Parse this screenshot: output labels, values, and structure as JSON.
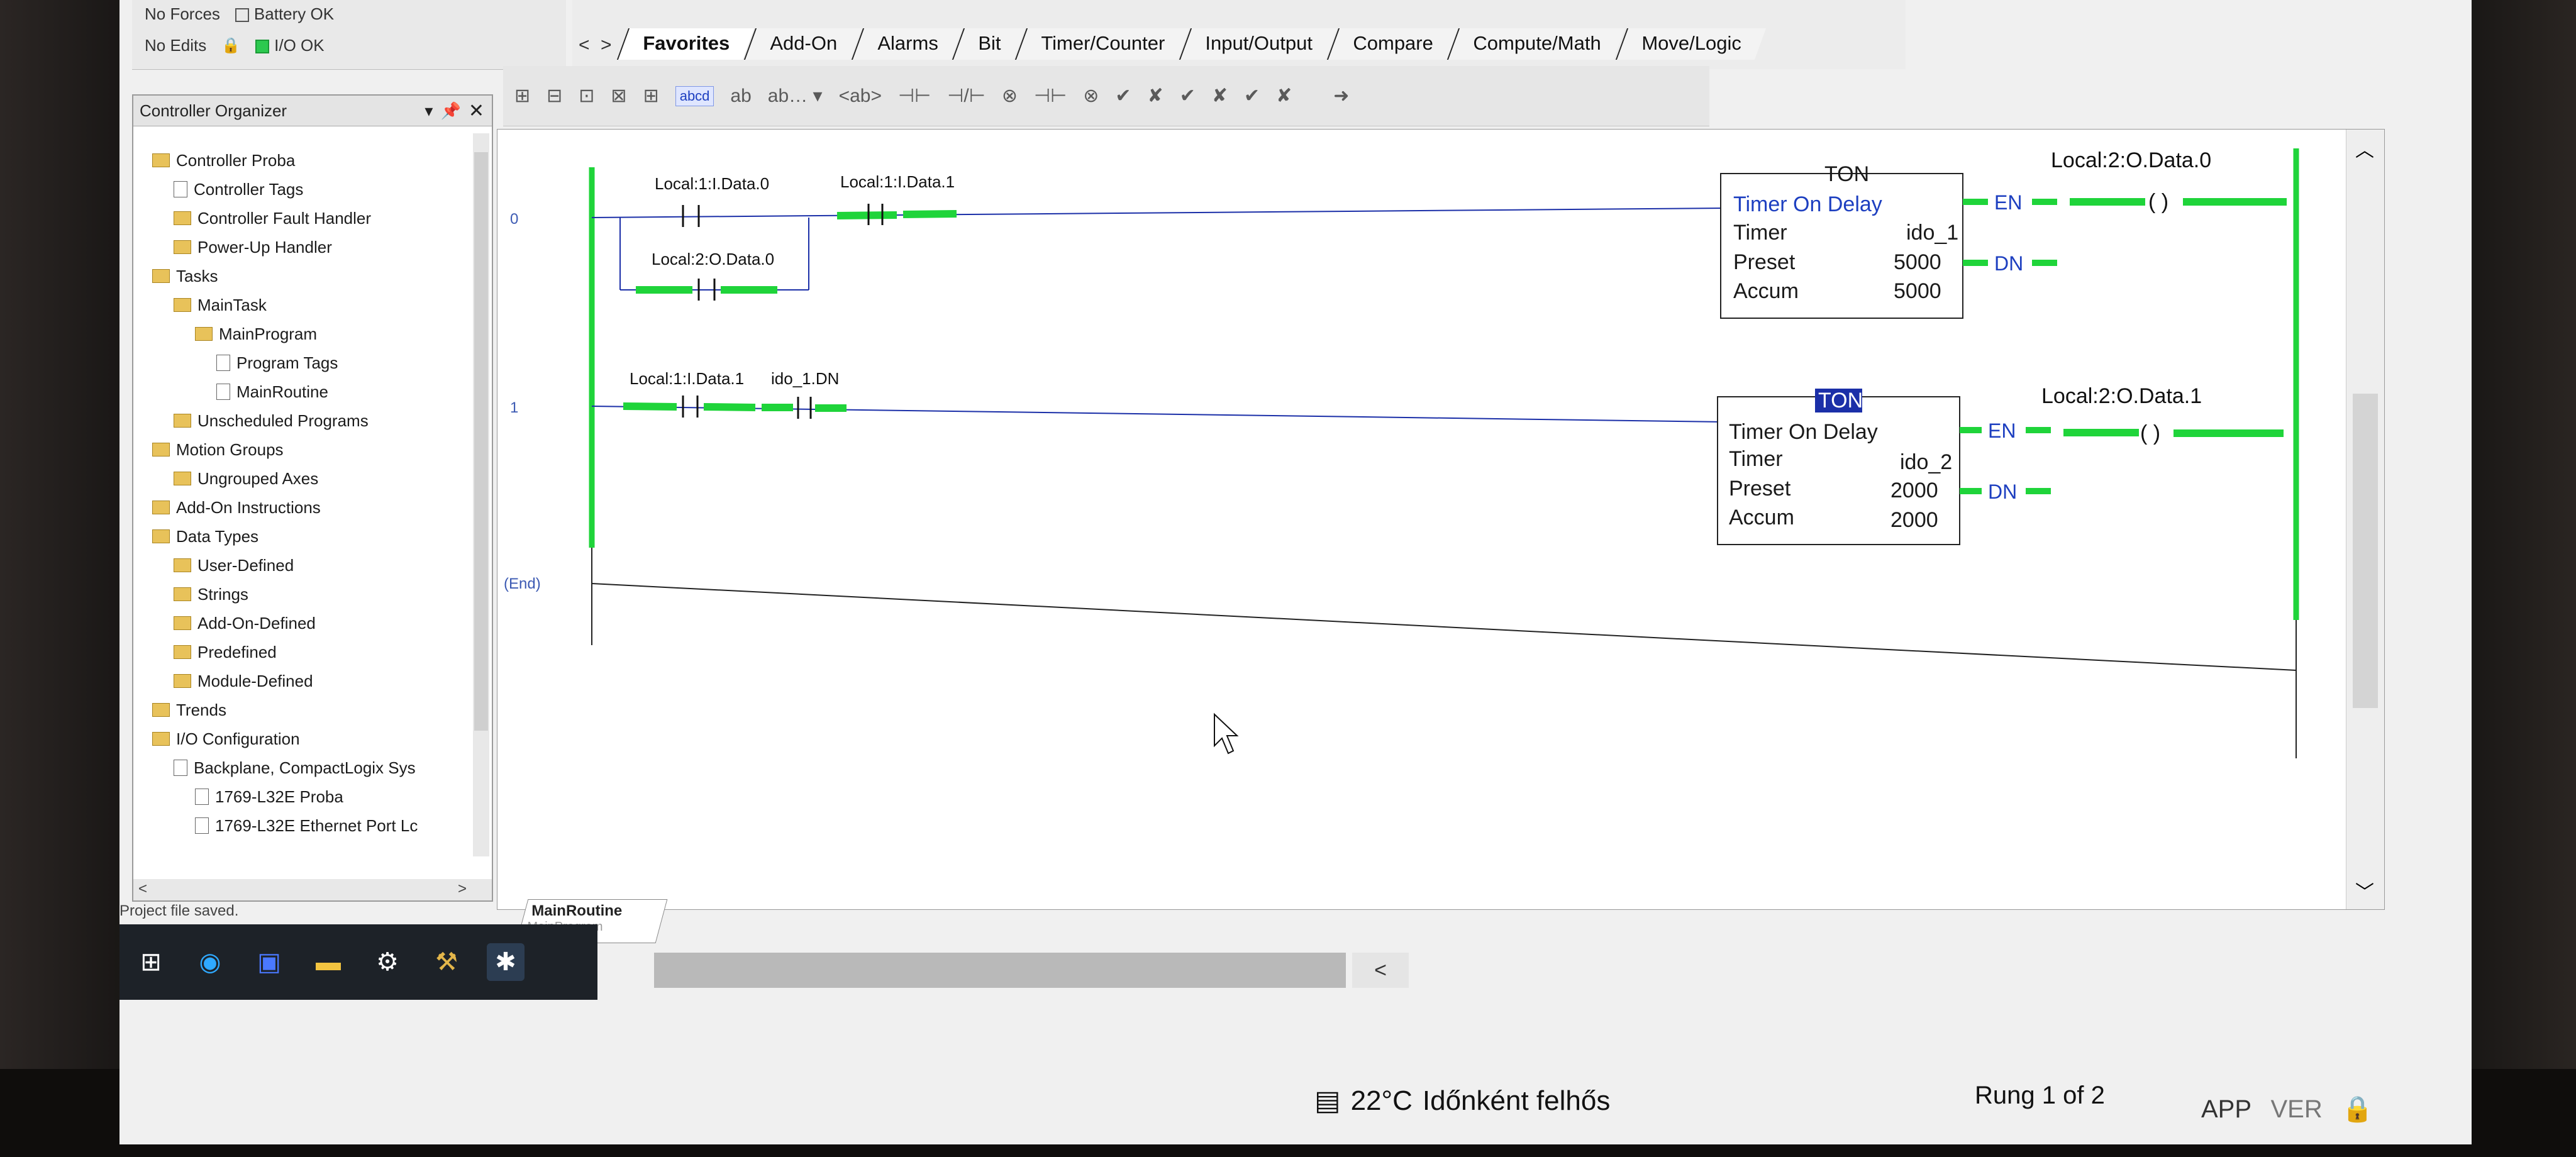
{
  "status": {
    "forces": "No Forces",
    "edits": "No Edits",
    "battery": "Battery OK",
    "io": "I/O OK"
  },
  "instruction_tabs": [
    "Favorites",
    "Add-On",
    "Alarms",
    "Bit",
    "Timer/Counter",
    "Input/Output",
    "Compare",
    "Compute/Math",
    "Move/Logic"
  ],
  "organizer": {
    "title": "Controller Organizer",
    "tree": [
      {
        "label": "Controller Proba",
        "level": 0,
        "icon": "folder-icon"
      },
      {
        "label": "Controller Tags",
        "level": 1,
        "icon": "tags-icon"
      },
      {
        "label": "Controller Fault Handler",
        "level": 1,
        "icon": "folder-icon"
      },
      {
        "label": "Power-Up Handler",
        "level": 1,
        "icon": "folder-icon"
      },
      {
        "label": "Tasks",
        "level": 0,
        "icon": "folder-icon"
      },
      {
        "label": "MainTask",
        "level": 1,
        "icon": "task-icon"
      },
      {
        "label": "MainProgram",
        "level": 2,
        "icon": "program-icon"
      },
      {
        "label": "Program Tags",
        "level": 3,
        "icon": "tags-icon"
      },
      {
        "label": "MainRoutine",
        "level": 3,
        "icon": "routine-icon"
      },
      {
        "label": "Unscheduled Programs",
        "level": 1,
        "icon": "folder-icon"
      },
      {
        "label": "Motion Groups",
        "level": 0,
        "icon": "folder-icon"
      },
      {
        "label": "Ungrouped Axes",
        "level": 1,
        "icon": "folder-icon"
      },
      {
        "label": "Add-On Instructions",
        "level": 0,
        "icon": "folder-icon"
      },
      {
        "label": "Data Types",
        "level": 0,
        "icon": "folder-icon"
      },
      {
        "label": "User-Defined",
        "level": 1,
        "icon": "folder-icon"
      },
      {
        "label": "Strings",
        "level": 1,
        "icon": "folder-icon"
      },
      {
        "label": "Add-On-Defined",
        "level": 1,
        "icon": "folder-icon"
      },
      {
        "label": "Predefined",
        "level": 1,
        "icon": "folder-icon"
      },
      {
        "label": "Module-Defined",
        "level": 1,
        "icon": "folder-icon"
      },
      {
        "label": "Trends",
        "level": 0,
        "icon": "folder-icon"
      },
      {
        "label": "I/O Configuration",
        "level": 0,
        "icon": "folder-icon"
      },
      {
        "label": "Backplane, CompactLogix Sys",
        "level": 1,
        "icon": "backplane-icon"
      },
      {
        "label": "1769-L32E Proba",
        "level": 2,
        "icon": "module-icon"
      },
      {
        "label": "1769-L32E Ethernet Port Lc",
        "level": 2,
        "icon": "ethernet-icon"
      }
    ]
  },
  "status_message": "Project file saved.",
  "ladder": {
    "rungs": [
      {
        "number": "0",
        "contacts": [
          "Local:1:I.Data.0",
          "Local:1:I.Data.1"
        ],
        "branch_contact": "Local:2:O.Data.0",
        "timer": {
          "type": "TON",
          "title": "Timer On Delay",
          "tag": "ido_1",
          "preset": "5000",
          "accum": "5000"
        },
        "en": "EN",
        "dn": "DN",
        "coil": "Local:2:O.Data.0"
      },
      {
        "number": "1",
        "contacts": [
          "Local:1:I.Data.1",
          "ido_1.DN"
        ],
        "timer": {
          "type": "TON",
          "title": "Timer On Delay",
          "tag": "ido_2",
          "preset": "2000",
          "accum": "2000"
        },
        "en": "EN",
        "dn": "DN",
        "coil": "Local:2:O.Data.1"
      }
    ],
    "end_label": "(End)",
    "field_labels": {
      "timer": "Timer",
      "preset": "Preset",
      "accum": "Accum"
    }
  },
  "routine_tab": {
    "name": "MainRoutine",
    "program": "MainProgram"
  },
  "bottom": {
    "temperature": "22°C",
    "weather": "Időnként felhős",
    "rung_position": "Rung 1 of 2",
    "app": "APP",
    "ver": "VER"
  },
  "colors": {
    "energized": "#1fd43a",
    "wire": "#1b2fa8",
    "rail": "#1fd43a"
  }
}
